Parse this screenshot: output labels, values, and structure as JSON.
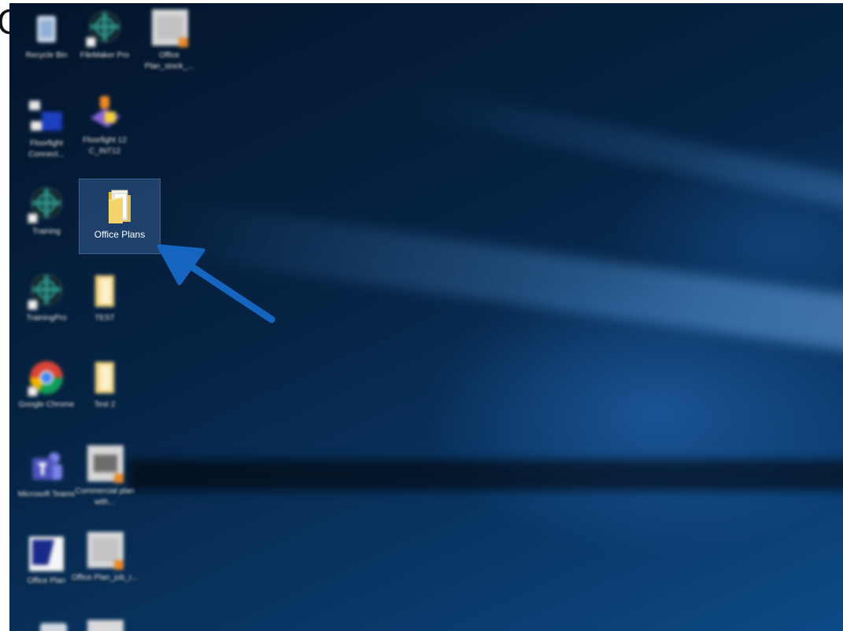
{
  "page": {
    "leading_glyph": "C"
  },
  "selected_icon": {
    "label": "Office Plans",
    "icon": "folder-icon"
  },
  "desktop_icons": [
    {
      "label": "Recycle Bin",
      "icon": "recycle-bin-icon"
    },
    {
      "label": "FileMaker Pro",
      "icon": "filemaker-icon"
    },
    {
      "label": "Office Plan_stock_...",
      "icon": "image-file-icon"
    },
    {
      "label": "Floorfight Connect...",
      "icon": "network-app-icon"
    },
    {
      "label": "Floorfight 12 C_INT12",
      "icon": "installer-icon"
    },
    {
      "label": "Training",
      "icon": "filemaker-icon"
    },
    {
      "label": "TrainingPro",
      "icon": "filemaker-icon"
    },
    {
      "label": "TEST",
      "icon": "folder-icon"
    },
    {
      "label": "Google Chrome",
      "icon": "chrome-icon"
    },
    {
      "label": "Test 2",
      "icon": "folder-icon"
    },
    {
      "label": "Microsoft Teams",
      "icon": "teams-icon"
    },
    {
      "label": "Commercial plan with...",
      "icon": "image-file-icon"
    },
    {
      "label": "Office Plan",
      "icon": "plan-app-icon"
    },
    {
      "label": "Office Plan_job_r...",
      "icon": "image-file-icon"
    }
  ],
  "annotation": {
    "arrow": "pointer-arrow",
    "color": "#1565c0"
  },
  "colors": {
    "desktop_dark": "#03142a",
    "desktop_light": "#0d4a86",
    "folder_yellow": "#f1c84b"
  }
}
